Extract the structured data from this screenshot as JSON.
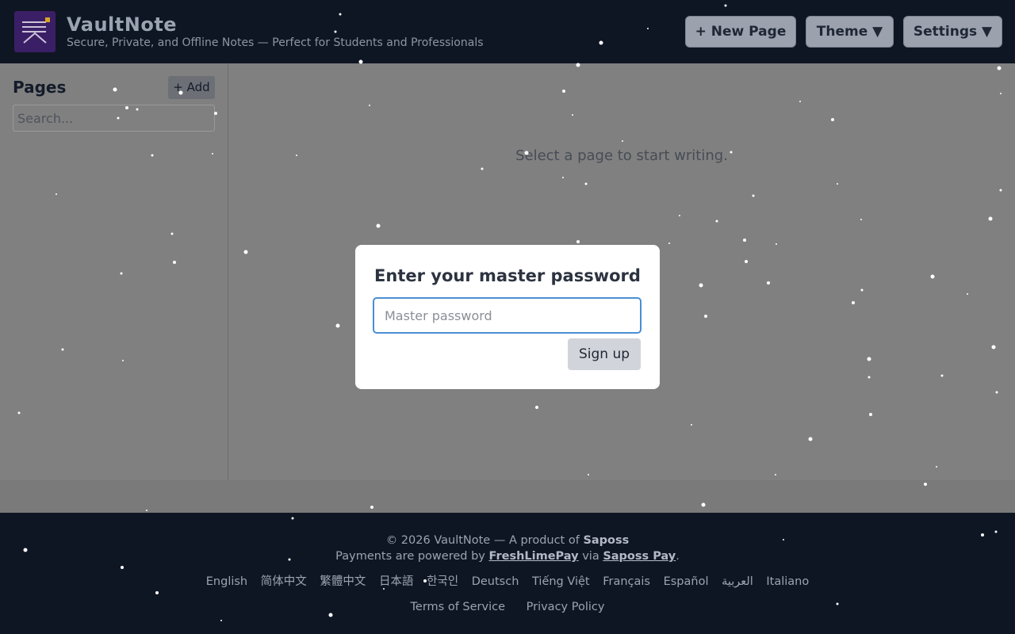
{
  "header": {
    "app_name": "VaultNote",
    "tagline": "Secure, Private, and Offline Notes — Perfect for Students and Professionals",
    "new_page_label": "+ New Page",
    "theme_label": "Theme ▼",
    "settings_label": "Settings ▼"
  },
  "sidebar": {
    "title": "Pages",
    "add_label": "+ Add",
    "search_placeholder": "Search..."
  },
  "main": {
    "empty_message": "Select a page to start writing."
  },
  "modal": {
    "title": "Enter your master password",
    "password_placeholder": "Master password",
    "submit_label": "Sign up"
  },
  "footer": {
    "copyright_prefix": "© 2026 VaultNote — A product of",
    "company": "Saposs",
    "payments_prefix": "Payments are powered by",
    "payment_provider": "FreshLimePay",
    "via": "via",
    "payment_platform": "Saposs Pay",
    "languages": [
      "English",
      "简体中文",
      "繁體中文",
      "日本語",
      "한국인",
      "Deutsch",
      "Tiếng Việt",
      "Français",
      "Español",
      "العربية",
      "Italiano"
    ],
    "terms_label": "Terms of Service",
    "privacy_label": "Privacy Policy"
  },
  "colors": {
    "header_bg": "#0f1623",
    "overlay_gray": "#808080",
    "input_focus": "#4a8fd4",
    "logo_bg": "#3b1f66",
    "logo_accent": "#d9a521"
  }
}
